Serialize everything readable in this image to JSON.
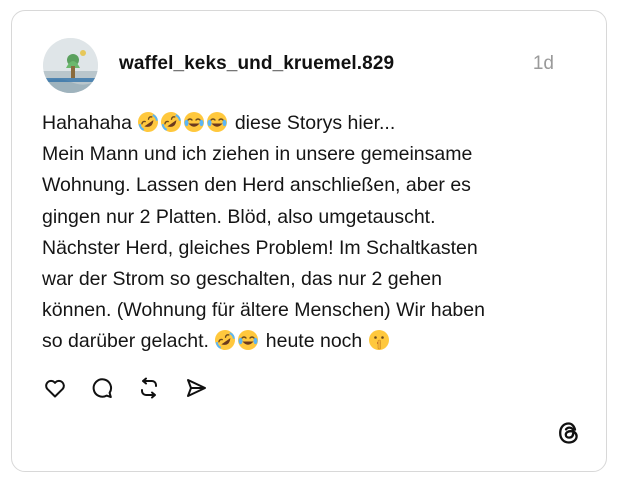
{
  "post": {
    "username": "waffel_keks_und_kruemel.829",
    "timestamp": "1d",
    "lines": [
      {
        "text": "Hahahaha ",
        "emojis_after": [
          "rolling-on-floor-laughing",
          "rolling-on-floor-laughing",
          "face-with-tears-of-joy",
          "face-with-tears-of-joy"
        ],
        "tail": " diese Storys hier..."
      },
      {
        "text": "Mein Mann und ich ziehen in unsere gemeinsame"
      },
      {
        "text": "Wohnung. Lassen den Herd anschließen, aber es"
      },
      {
        "text": "gingen nur 2 Platten. Blöd, also umgetauscht."
      },
      {
        "text": "Nächster Herd, gleiches Problem! Im Schaltkasten"
      },
      {
        "text": "war der Strom so geschalten, das nur 2 gehen"
      },
      {
        "text": "können. (Wohnung für ältere Menschen) Wir haben"
      },
      {
        "text": "so darüber gelacht. ",
        "emojis_after": [
          "rolling-on-floor-laughing",
          "face-with-tears-of-joy"
        ],
        "tail": " heute noch ",
        "emojis_end": [
          "shushing-face"
        ]
      }
    ]
  },
  "actions": [
    {
      "name": "like-button",
      "icon": "heart-icon"
    },
    {
      "name": "reply-button",
      "icon": "comment-icon"
    },
    {
      "name": "repost-button",
      "icon": "repost-icon"
    },
    {
      "name": "share-button",
      "icon": "send-icon"
    }
  ],
  "brand": {
    "logo": "threads-logo-icon"
  },
  "colors": {
    "text": "#151515",
    "muted": "#9a9a9a",
    "border": "#d8d8d8",
    "emoji_yellow": "#FFC83D",
    "tear_blue": "#5BB5F5"
  }
}
